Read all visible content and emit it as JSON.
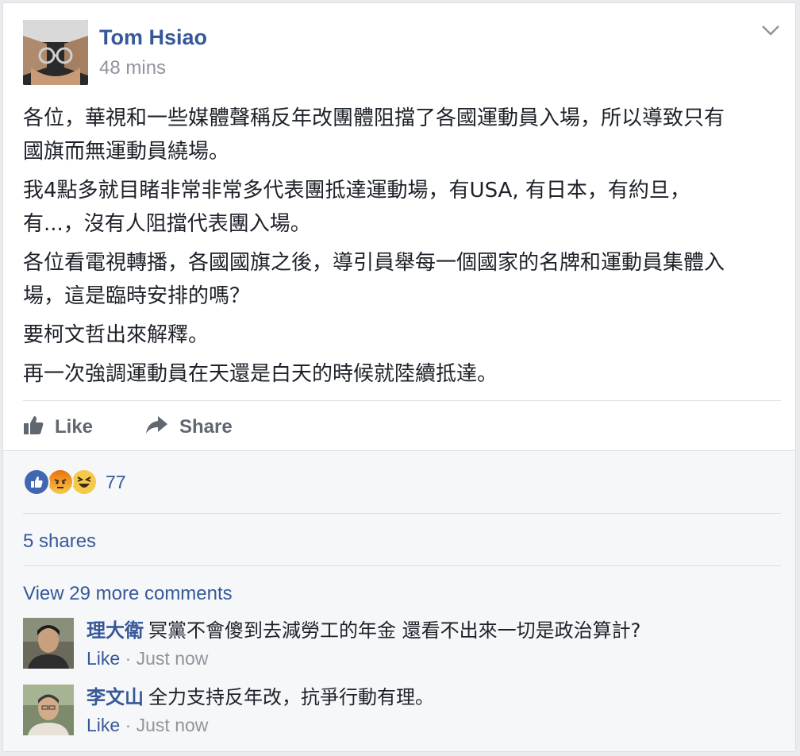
{
  "post": {
    "author": "Tom Hsiao",
    "time": "48 mins",
    "paragraphs": [
      "各位，華視和一些媒體聲稱反年改團體阻擋了各國運動員入場，所以導致只有\n國旗而無運動員繞場。",
      "我4點多就目睹非常非常多代表團抵達運動場，有USA, 有日本，有約旦，\n有...，沒有人阻擋代表團入場。",
      "各位看電視轉播，各國國旗之後，導引員舉每一個國家的名牌和運動員集體入\n場，這是臨時安排的嗎？",
      "要柯文哲出來解釋。",
      "再一次強調運動員在天還是白天的時候就陸續抵達。"
    ]
  },
  "actions": {
    "like_label": "Like",
    "share_label": "Share"
  },
  "feedback": {
    "reactions": [
      "like-reaction-icon",
      "angry-reaction-icon",
      "haha-reaction-icon"
    ],
    "reaction_count": "77",
    "shares": "5 shares",
    "more_comments": "View 29 more comments"
  },
  "comments": [
    {
      "author": "理大衛",
      "text": "冥黨不會傻到去減勞工的年金 還看不出來一切是政治算計?",
      "like_label": "Like",
      "time": " · Just now"
    },
    {
      "author": "李文山",
      "text": "全力支持反年改，抗爭行動有理。",
      "like_label": "Like",
      "time": " · Just now"
    }
  ],
  "colors": {
    "link_blue": "#365899",
    "text": "#1d2129",
    "secondary": "#90949c",
    "like_blue": "#4267b2",
    "emoji_yellow": "#f7c94b",
    "angry_orange": "#e9710f"
  }
}
